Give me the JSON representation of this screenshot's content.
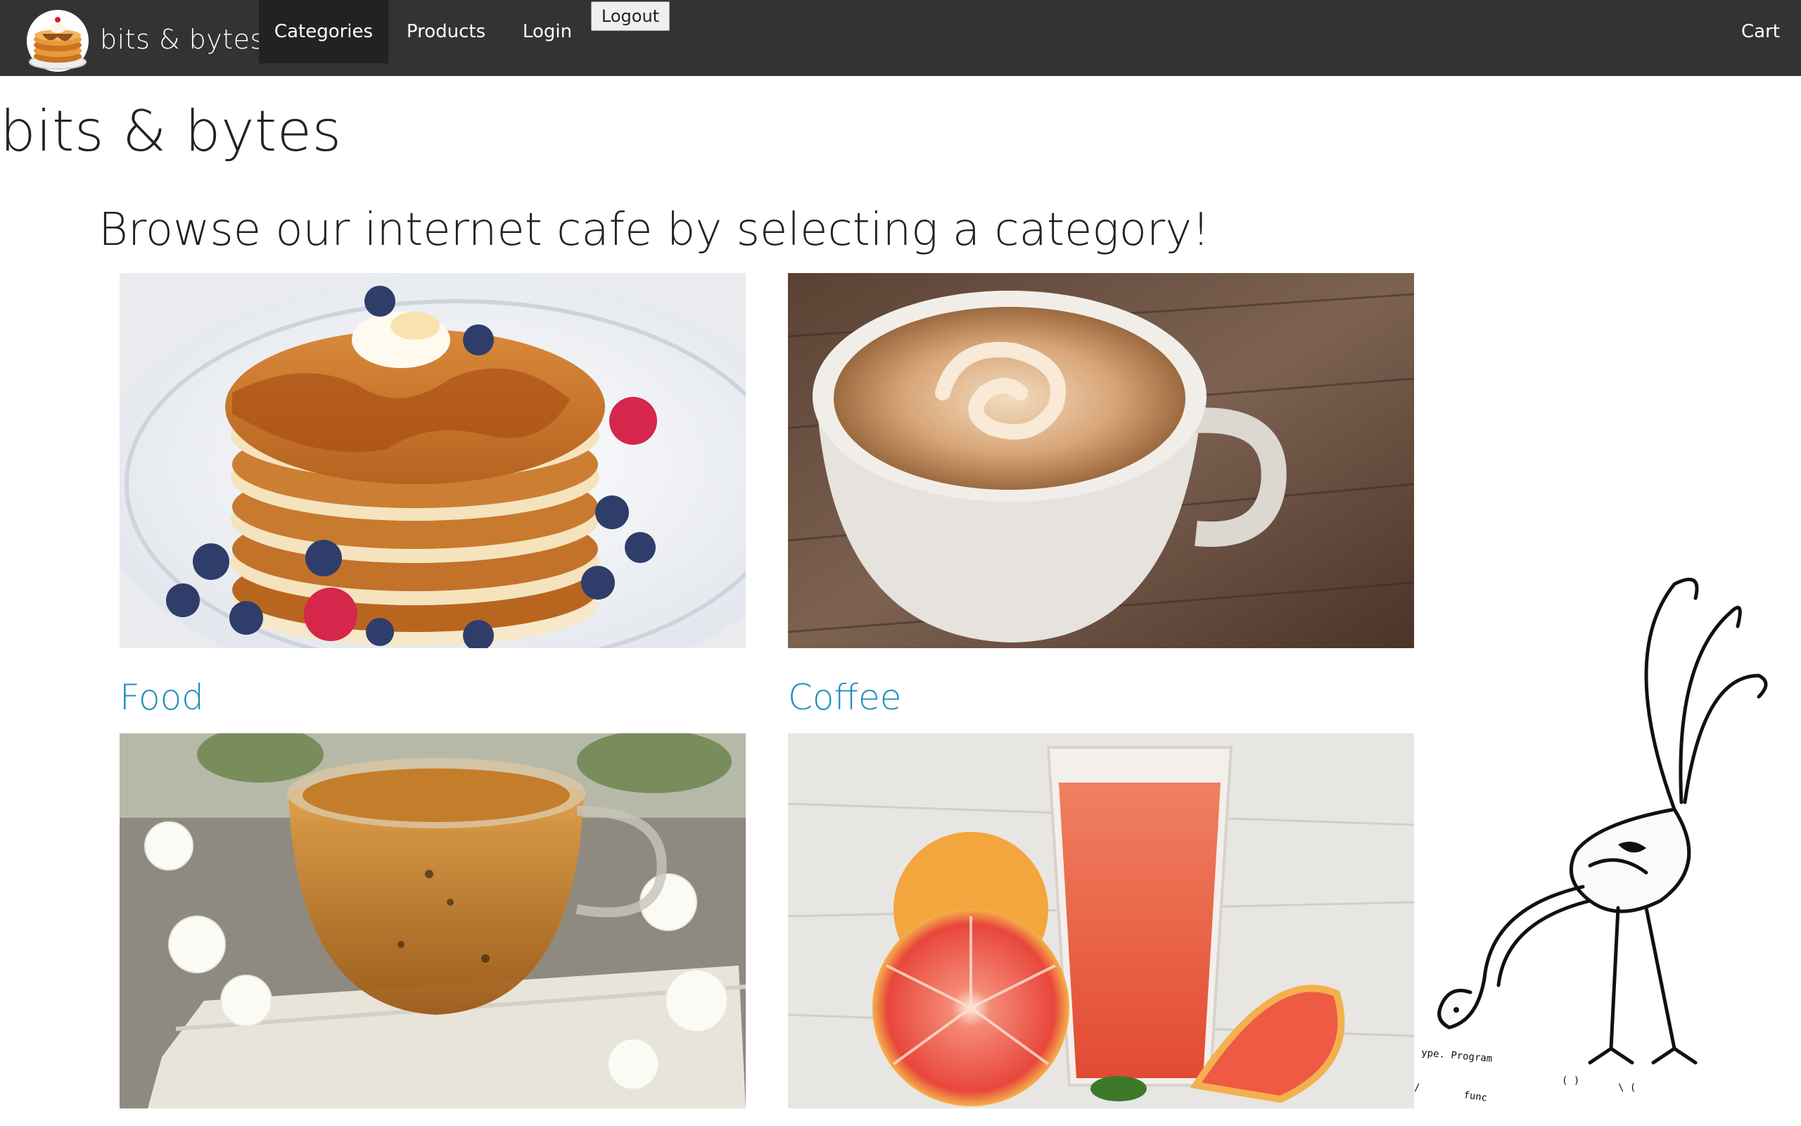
{
  "navbar": {
    "brand": "bits & bytes",
    "items": [
      {
        "label": "Categories",
        "active": true
      },
      {
        "label": "Products",
        "active": false
      },
      {
        "label": "Login",
        "active": false
      }
    ],
    "logout_label": "Logout",
    "cart_label": "Cart"
  },
  "page": {
    "title": "bits & bytes",
    "subtitle": "Browse our internet cafe by selecting a category!"
  },
  "categories": [
    {
      "label": "Food",
      "image": "pancakes-with-blueberries"
    },
    {
      "label": "Coffee",
      "image": "latte-cup"
    },
    {
      "label": "",
      "image": "glass-tea-cup"
    },
    {
      "label": "",
      "image": "grapefruit-juice"
    }
  ],
  "colors": {
    "navbar_bg": "#333333",
    "active_nav_bg": "#222222",
    "link": "#1d8ec0",
    "text": "#222222"
  }
}
